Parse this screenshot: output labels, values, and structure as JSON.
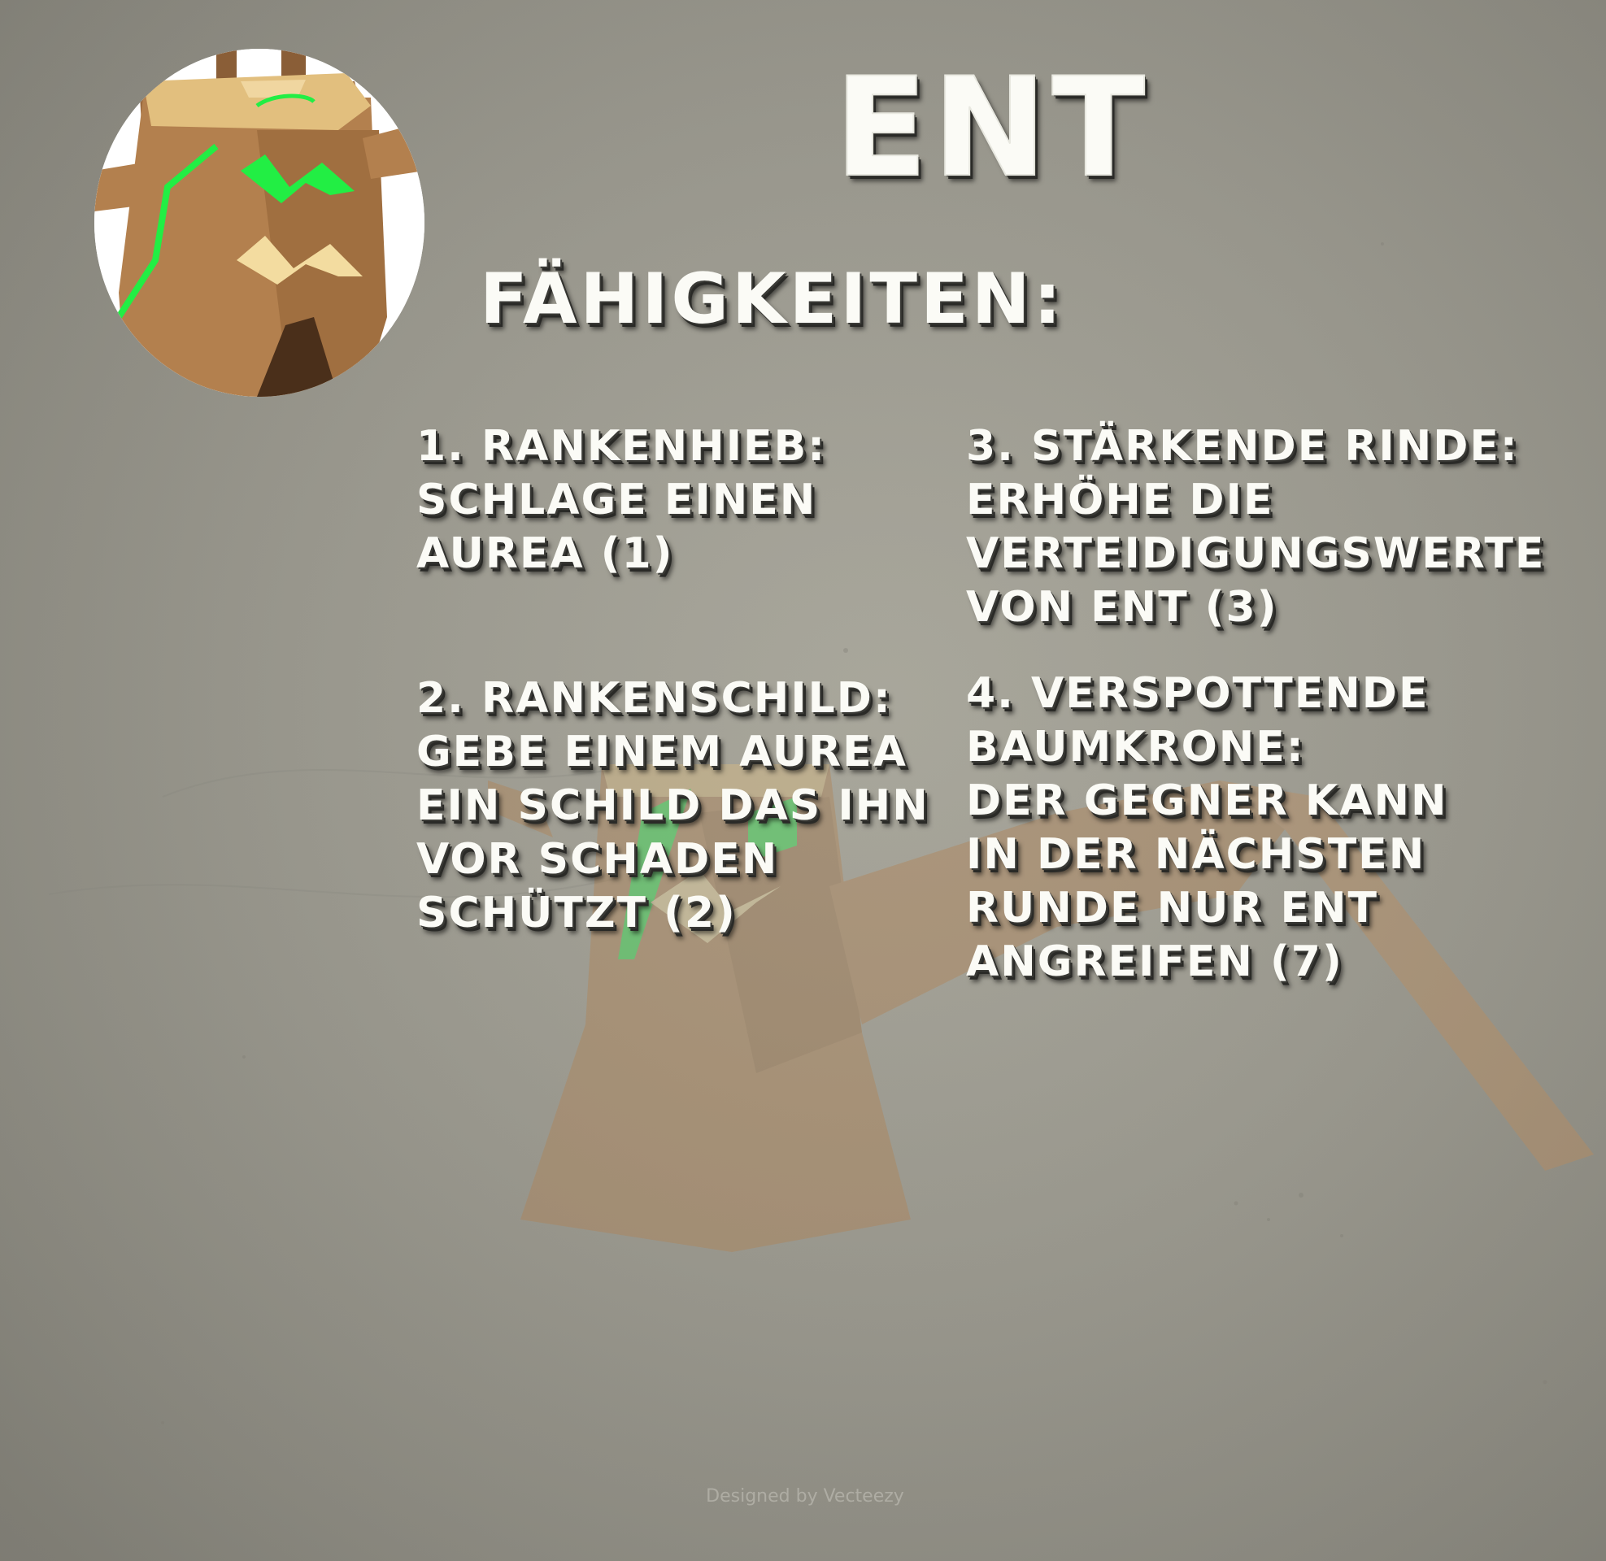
{
  "title": "ENT",
  "subtitle": "FÄHIGKEITEN:",
  "abilities": [
    {
      "lines": [
        "1. RANKENHIEB:",
        "SCHLAGE EINEN",
        "AUREA (1)"
      ]
    },
    {
      "lines": [
        "2. RANKENSCHILD:",
        "GEBE EINEM AUREA",
        "EIN SCHILD DAS IHN",
        "VOR SCHADEN",
        "SCHÜTZT (2)"
      ]
    },
    {
      "lines": [
        "3. STÄRKENDE RINDE:",
        "ERHÖHE DIE",
        "VERTEIDIGUNGSWERTE",
        "VON ENT (3)"
      ]
    },
    {
      "lines": [
        "4. VERSPOTTENDE",
        "BAUMKRONE:",
        "DER GEGNER KANN",
        "IN DER NÄCHSTEN",
        "RUNDE NUR ENT",
        "ANGREIFEN (7)"
      ]
    }
  ],
  "watermark": "Designed by Vecteezy",
  "colors": {
    "background": "#9b998e",
    "text": "#fbfbf6",
    "bark": "#b3804e",
    "bark_top": "#e2bf7e",
    "vine": "#22ee44",
    "crack": "#f3dca0",
    "flower": "#e8765c"
  },
  "icons": {
    "portrait": "ent-tree-stump-portrait",
    "background_art": "ent-tree-creature-illustration"
  }
}
